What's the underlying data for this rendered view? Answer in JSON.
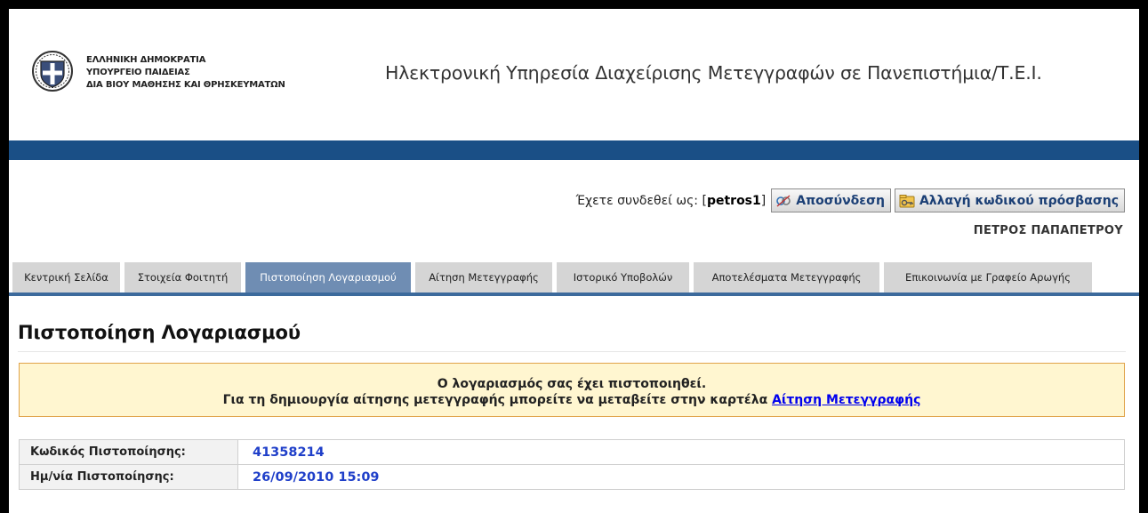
{
  "header": {
    "ministry_lines": [
      "ΕΛΛΗΝΙΚΗ ΔΗΜΟΚΡΑΤΙΑ",
      "ΥΠΟΥΡΓΕΙΟ ΠΑΙΔΕΙΑΣ",
      "ΔΙΑ ΒΙΟΥ ΜΑΘΗΣΗΣ ΚΑΙ ΘΡΗΣΚΕΥΜΑΤΩΝ"
    ],
    "site_title": "Ηλεκτρονική Υπηρεσία Διαχείρισης Μετεγγραφών σε Πανεπιστήμια/Τ.Ε.Ι.",
    "bar_color": "#1a4f86"
  },
  "user": {
    "logged_in_prefix": "Έχετε συνδεθεί ως: [",
    "username": "petros1",
    "logged_in_suffix": "]",
    "logout_label": "Αποσύνδεση",
    "change_password_label": "Αλλαγή κωδικού πρόσβασης",
    "full_name": "ΠΕΤΡΟΣ ΠΑΠΑΠΕΤΡΟΥ"
  },
  "tabs": [
    {
      "label": "Κεντρική Σελίδα",
      "active": false
    },
    {
      "label": "Στοιχεία Φοιτητή",
      "active": false
    },
    {
      "label": "Πιστοποίηση Λογαριασμού",
      "active": true
    },
    {
      "label": "Αίτηση Μετεγγραφής",
      "active": false
    },
    {
      "label": "Ιστορικό Υποβολών",
      "active": false
    },
    {
      "label": "Αποτελέσματα Μετεγγραφής",
      "active": false
    },
    {
      "label": "Επικοινωνία με Γραφείο Αρωγής",
      "active": false
    }
  ],
  "main": {
    "title": "Πιστοποίηση Λογαριασμού",
    "notice": {
      "line1": "Ο λογαριασμός σας έχει πιστοποιηθεί.",
      "line2_prefix": "Για τη δημιουργία αίτησης μετεγγραφής μπορείτε να μεταβείτε στην καρτέλα ",
      "line2_link": "Αίτηση Μετεγγραφής"
    },
    "info_rows": [
      {
        "label": "Κωδικός Πιστοποίησης:",
        "value": "41358214"
      },
      {
        "label": "Ημ/νία Πιστοποίησης:",
        "value": "26/09/2010 15:09"
      }
    ]
  }
}
